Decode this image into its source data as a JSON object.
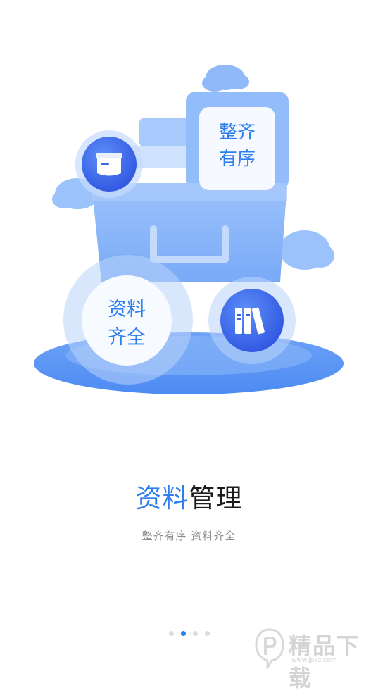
{
  "illustration": {
    "bubble_top": "整齐\n有序",
    "bubble_left": "资料\n齐全",
    "bubble_top_line1": "整齐",
    "bubble_top_line2": "有序",
    "bubble_left_line1": "资料",
    "bubble_left_line2": "齐全",
    "icons": [
      "box-icon",
      "books-icon"
    ],
    "colors": {
      "primary": "#2f7ef0",
      "light": "#aac9fb",
      "cloud": "#8fb9f9"
    }
  },
  "title": {
    "accent": "资料",
    "main": "管理"
  },
  "subtitle": "整齐有序  资料齐全",
  "pager": {
    "total": 4,
    "active_index": 1
  },
  "watermark": {
    "text": "精品下载",
    "url": "www.jpxz.com"
  }
}
